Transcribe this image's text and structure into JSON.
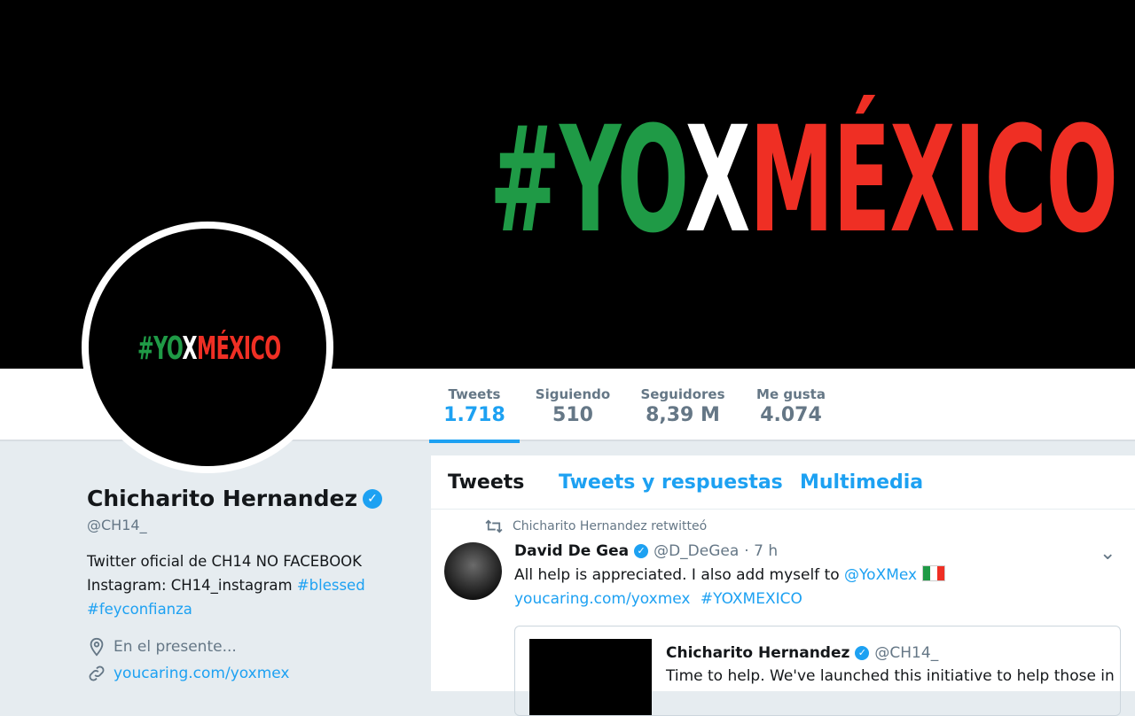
{
  "banner": {
    "hashtag_parts": [
      "#YO",
      "X",
      "MÉXICO"
    ]
  },
  "avatar": {
    "hashtag_parts": [
      "#YO",
      "X",
      "MÉXICO"
    ]
  },
  "stats": [
    {
      "label": "Tweets",
      "value": "1.718"
    },
    {
      "label": "Siguiendo",
      "value": "510"
    },
    {
      "label": "Seguidores",
      "value": "8,39 M"
    },
    {
      "label": "Me gusta",
      "value": "4.074"
    }
  ],
  "profile": {
    "name": "Chicharito Hernandez",
    "handle": "@CH14_",
    "bio_line1": "Twitter oficial de CH14 NO FACEBOOK",
    "bio_line2_prefix": "Instagram: CH14_instagram ",
    "bio_tag1": "#blessed",
    "bio_tag2": "#feyconfianza",
    "location": "En el presente...",
    "url": "youcaring.com/yoxmex"
  },
  "tabs": [
    "Tweets",
    "Tweets y respuestas",
    "Multimedia"
  ],
  "tweet": {
    "retweet_label": "Chicharito Hernandez retwitteó",
    "author_name": "David De Gea",
    "author_handle": "@D_DeGea",
    "time": "· 7 h",
    "text_prefix": "All help is appreciated. I also add myself to ",
    "mention": "@YoXMex",
    "link1": "youcaring.com/yoxmex",
    "link2": "#YOXMEXICO",
    "quote": {
      "author_name": "Chicharito Hernandez",
      "author_handle": "@CH14_",
      "text": "Time to help. We've launched this initiative to help those in"
    }
  },
  "colors": {
    "accent": "#1da1f2",
    "green": "#1f9a46",
    "red": "#ef2f24"
  }
}
